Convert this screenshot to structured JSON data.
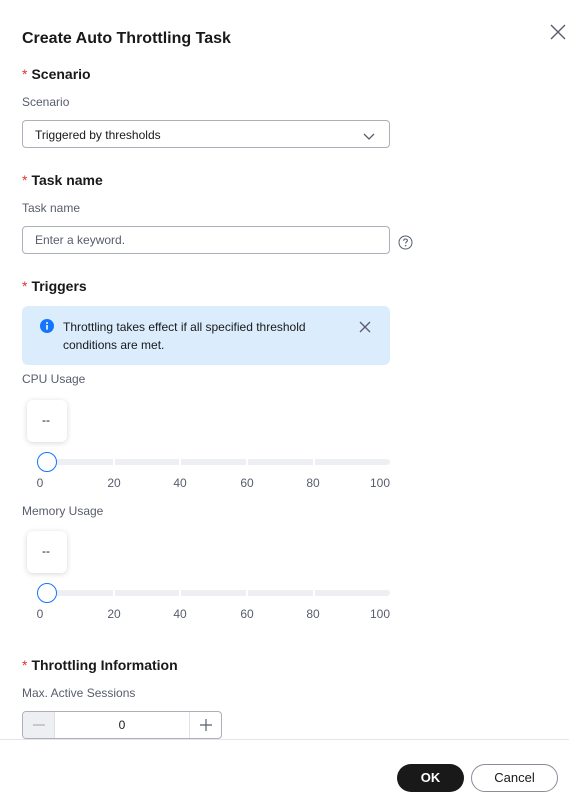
{
  "dialog": {
    "title": "Create Auto Throttling Task",
    "close_icon": "close-icon"
  },
  "scenario": {
    "section_title": "Scenario",
    "required_mark": "*",
    "field_label": "Scenario",
    "selected_value": "Triggered by thresholds"
  },
  "task_name": {
    "section_title": "Task name",
    "required_mark": "*",
    "field_label": "Task name",
    "value": "",
    "placeholder": "Enter a keyword."
  },
  "triggers": {
    "section_title": "Triggers",
    "required_mark": "*",
    "alert_text": "Throttling takes effect if all specified threshold conditions are met.",
    "cpu": {
      "label": "CPU Usage",
      "tooltip": "--",
      "value": 0,
      "scale": [
        "0",
        "20",
        "40",
        "60",
        "80",
        "100"
      ]
    },
    "memory": {
      "label": "Memory Usage",
      "tooltip": "--",
      "value": 0,
      "scale": [
        "0",
        "20",
        "40",
        "60",
        "80",
        "100"
      ]
    }
  },
  "throttling": {
    "section_title": "Throttling Information",
    "required_mark": "*",
    "field_label": "Max. Active Sessions",
    "value": "0"
  },
  "footer": {
    "ok_label": "OK",
    "cancel_label": "Cancel"
  },
  "colors": {
    "accent": "#1476ff",
    "required": "#e1342f",
    "alert_bg": "#dbecfd",
    "primary_button": "#191919"
  }
}
